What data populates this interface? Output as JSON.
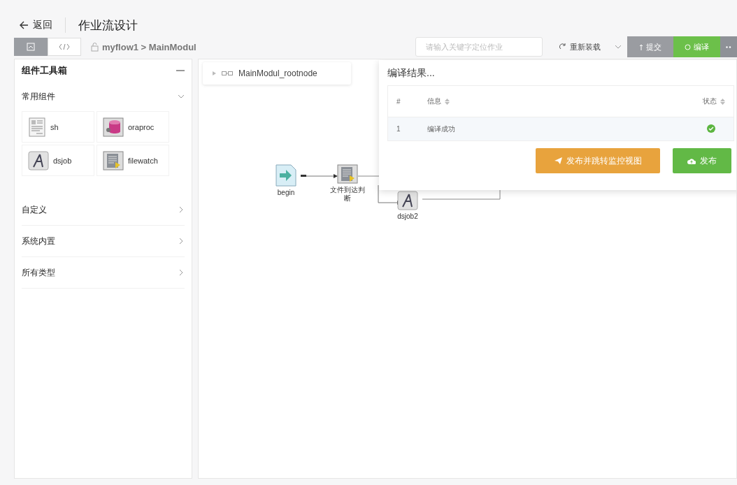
{
  "header": {
    "back": "返回",
    "title": "作业流设计"
  },
  "toolbar": {
    "view_toggle": [
      {
        "kind": "design",
        "selected": true
      },
      {
        "kind": "code",
        "selected": false
      }
    ],
    "breadcrumb": "myflow1 > MainModul",
    "search": {
      "placeholder": "请输入关键字定位作业"
    },
    "reload": "重新装载",
    "submit": {
      "label": "提交",
      "disabled": true
    },
    "compile": {
      "label": "编译",
      "disabled": false
    }
  },
  "toolbox": {
    "title": "组件工具箱",
    "sections": [
      {
        "label": "常用组件",
        "expanded": true,
        "items": [
          {
            "label": "sh",
            "kind": "sh"
          },
          {
            "label": "oraproc",
            "kind": "oraproc"
          },
          {
            "label": "dsjob",
            "kind": "dsjob"
          },
          {
            "label": "filewatch",
            "kind": "filewatch"
          }
        ]
      },
      {
        "label": "自定义",
        "expanded": false
      },
      {
        "label": "系统内置",
        "expanded": false
      },
      {
        "label": "所有类型",
        "expanded": false
      }
    ]
  },
  "canvas": {
    "root": "MainModul_rootnode",
    "nodes": [
      {
        "label": "begin",
        "kind": "begin"
      },
      {
        "label": "文件到达判断",
        "kind": "filewatch"
      },
      {
        "label": "dsjob2",
        "kind": "dsjob"
      }
    ]
  },
  "compile_result": {
    "title": "编译结果...",
    "columns": [
      {
        "label": "#",
        "sortable": false
      },
      {
        "label": "信息",
        "sortable": true
      },
      {
        "label": "状态",
        "sortable": true
      }
    ],
    "rows": [
      {
        "index": "1",
        "message": "编译成功",
        "succeeded": true
      }
    ],
    "buttons": [
      {
        "label": "发布并跳转监控视图",
        "kind": "publish_monitor"
      },
      {
        "label": "发布",
        "kind": "publish"
      }
    ]
  }
}
